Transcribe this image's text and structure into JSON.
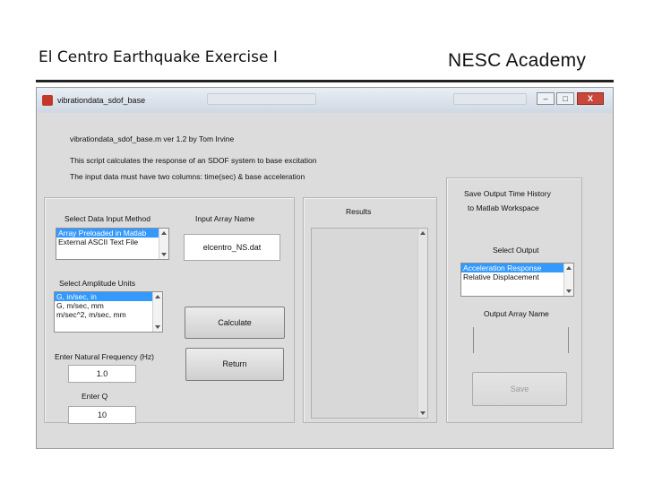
{
  "slide": {
    "title": "El Centro Earthquake Exercise I",
    "brand": "NESC Academy"
  },
  "window": {
    "title": "vibrationdata_sdof_base",
    "controls": {
      "minimize": "–",
      "maximize": "□",
      "close": "X"
    }
  },
  "intro": {
    "line1": "vibrationdata_sdof_base.m  ver 1.2  by Tom Irvine",
    "line2": "This script calculates the response of an SDOF system to base excitation",
    "line3": "The input data must have two columns:  time(sec) & base acceleration"
  },
  "input": {
    "method_label": "Select Data Input Method",
    "method_options": [
      "Array Preloaded in Matlab",
      "External ASCII Text File"
    ],
    "array_name_label": "Input Array Name",
    "array_name_value": "elcentro_NS.dat",
    "units_label": "Select Amplitude Units",
    "units_options": [
      "G, in/sec, in",
      "G, m/sec, mm",
      "m/sec^2, m/sec, mm"
    ],
    "freq_label": "Enter Natural Frequency (Hz)",
    "freq_value": "1.0",
    "q_label": "Enter Q",
    "q_value": "10",
    "calculate_label": "Calculate",
    "return_label": "Return"
  },
  "results": {
    "label": "Results"
  },
  "output": {
    "save_label_1": "Save Output Time History",
    "save_label_2": "to Matlab Workspace",
    "select_label": "Select Output",
    "options": [
      "Acceleration Response",
      "Relative Displacement"
    ],
    "array_name_label": "Output Array Name",
    "array_name_value": "",
    "save_button": "Save"
  }
}
